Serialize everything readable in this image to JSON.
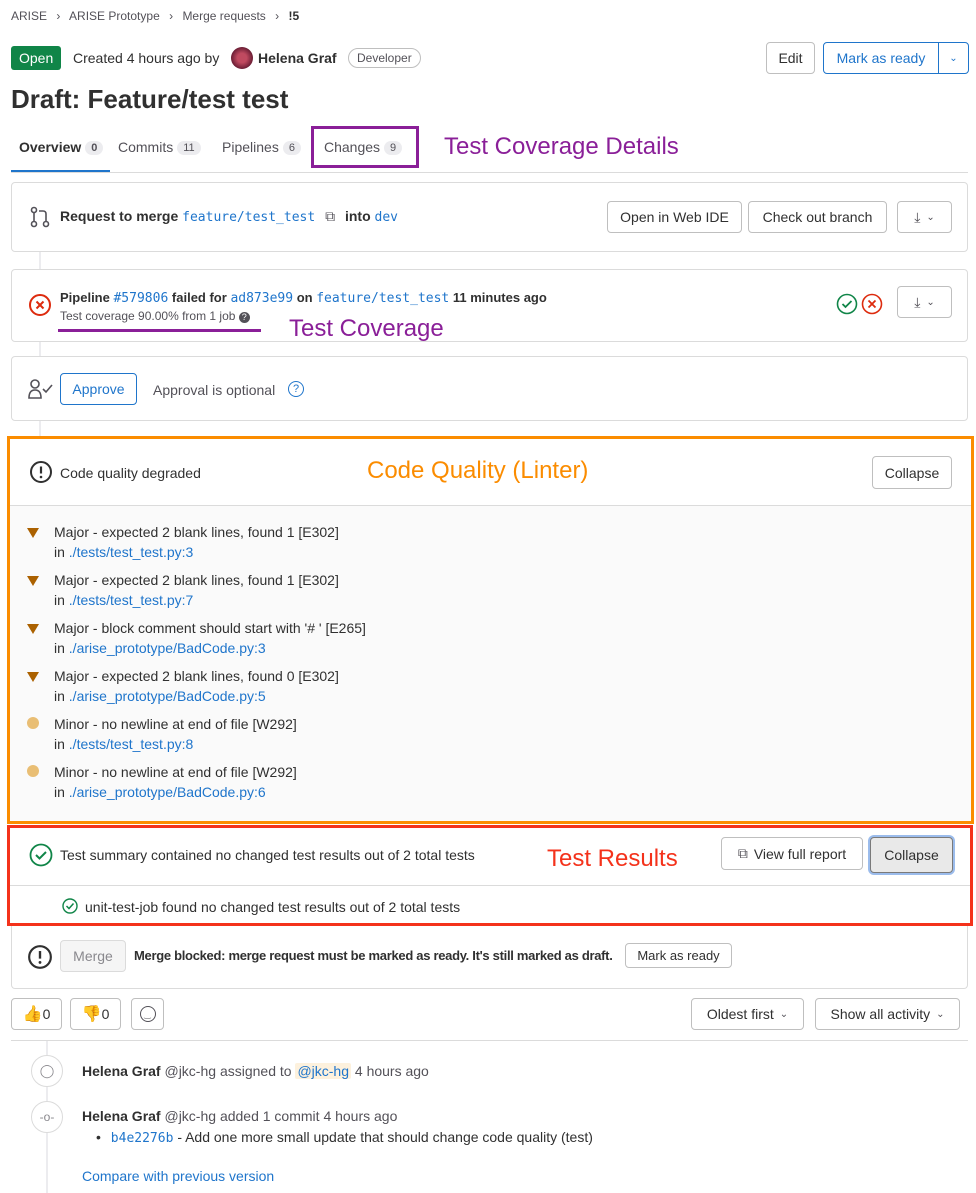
{
  "breadcrumb": [
    "ARISE",
    "ARISE Prototype",
    "Merge requests",
    "!5"
  ],
  "header": {
    "status": "Open",
    "created_text": "Created 4 hours ago by",
    "author": "Helena Graf",
    "role": "Developer",
    "edit_label": "Edit",
    "mark_ready_label": "Mark as ready",
    "title": "Draft: Feature/test test"
  },
  "tabs": [
    {
      "label": "Overview",
      "count": "0"
    },
    {
      "label": "Commits",
      "count": "11"
    },
    {
      "label": "Pipelines",
      "count": "6"
    },
    {
      "label": "Changes",
      "count": "9"
    }
  ],
  "annotations": {
    "coverage_details": "Test Coverage Details",
    "coverage": "Test Coverage",
    "code_quality": "Code Quality (Linter)",
    "test_results": "Test Results"
  },
  "merge_request": {
    "request_label": "Request to merge",
    "source_branch": "feature/test_test",
    "into_label": "into",
    "target_branch": "dev",
    "web_ide_label": "Open in Web IDE",
    "checkout_label": "Check out branch"
  },
  "pipeline": {
    "prefix": "Pipeline",
    "id": "#579806",
    "failed_for": "failed for",
    "commit": "ad873e99",
    "on": "on",
    "branch": "feature/test_test",
    "time": "11 minutes ago",
    "coverage_text": "Test coverage 90.00% from 1 job"
  },
  "approval": {
    "approve_label": "Approve",
    "optional_text": "Approval is optional"
  },
  "code_quality": {
    "title": "Code quality degraded",
    "collapse_label": "Collapse",
    "in_label": "in",
    "items": [
      {
        "severity": "major",
        "text": "Major - expected 2 blank lines, found 1 [E302]",
        "file": "./tests/test_test.py:3"
      },
      {
        "severity": "major",
        "text": "Major - expected 2 blank lines, found 1 [E302]",
        "file": "./tests/test_test.py:7"
      },
      {
        "severity": "major",
        "text": "Major - block comment should start with '# ' [E265]",
        "file": "./arise_prototype/BadCode.py:3"
      },
      {
        "severity": "major",
        "text": "Major - expected 2 blank lines, found 0 [E302]",
        "file": "./arise_prototype/BadCode.py:5"
      },
      {
        "severity": "minor",
        "text": "Minor - no newline at end of file [W292]",
        "file": "./tests/test_test.py:8"
      },
      {
        "severity": "minor",
        "text": "Minor - no newline at end of file [W292]",
        "file": "./arise_prototype/BadCode.py:6"
      }
    ]
  },
  "test_summary": {
    "title": "Test summary contained no changed test results out of 2 total tests",
    "view_report_label": "View full report",
    "collapse_label": "Collapse",
    "job_text": "unit-test-job found no changed test results out of 2 total tests"
  },
  "merge": {
    "merge_label": "Merge",
    "blocked_text": "Merge blocked: merge request must be marked as ready. It's still marked as draft.",
    "mark_ready_label": "Mark as ready"
  },
  "reactions": {
    "thumbs_up": "👍",
    "thumbs_up_count": "0",
    "thumbs_down": "👎",
    "thumbs_down_count": "0"
  },
  "sort": {
    "order_label": "Oldest first",
    "filter_label": "Show all activity"
  },
  "activity": [
    {
      "author": "Helena Graf",
      "handle": "@jkc-hg",
      "action": "assigned to",
      "target": "@jkc-hg",
      "time": "4 hours ago"
    },
    {
      "author": "Helena Graf",
      "handle": "@jkc-hg",
      "action": "added 1 commit",
      "time": "4 hours ago",
      "commit_sha": "b4e2276b",
      "commit_msg": "- Add one more small update that should change code quality (test)",
      "compare_label": "Compare with previous version"
    }
  ],
  "colors": {
    "accent": "#1f75cb",
    "open_badge": "#108548",
    "purple_annotation": "#8a1f98",
    "orange_annotation": "#fb8c00",
    "red_annotation": "#f4321b",
    "failed_red": "#dd2b0e",
    "success_green": "#108548"
  }
}
